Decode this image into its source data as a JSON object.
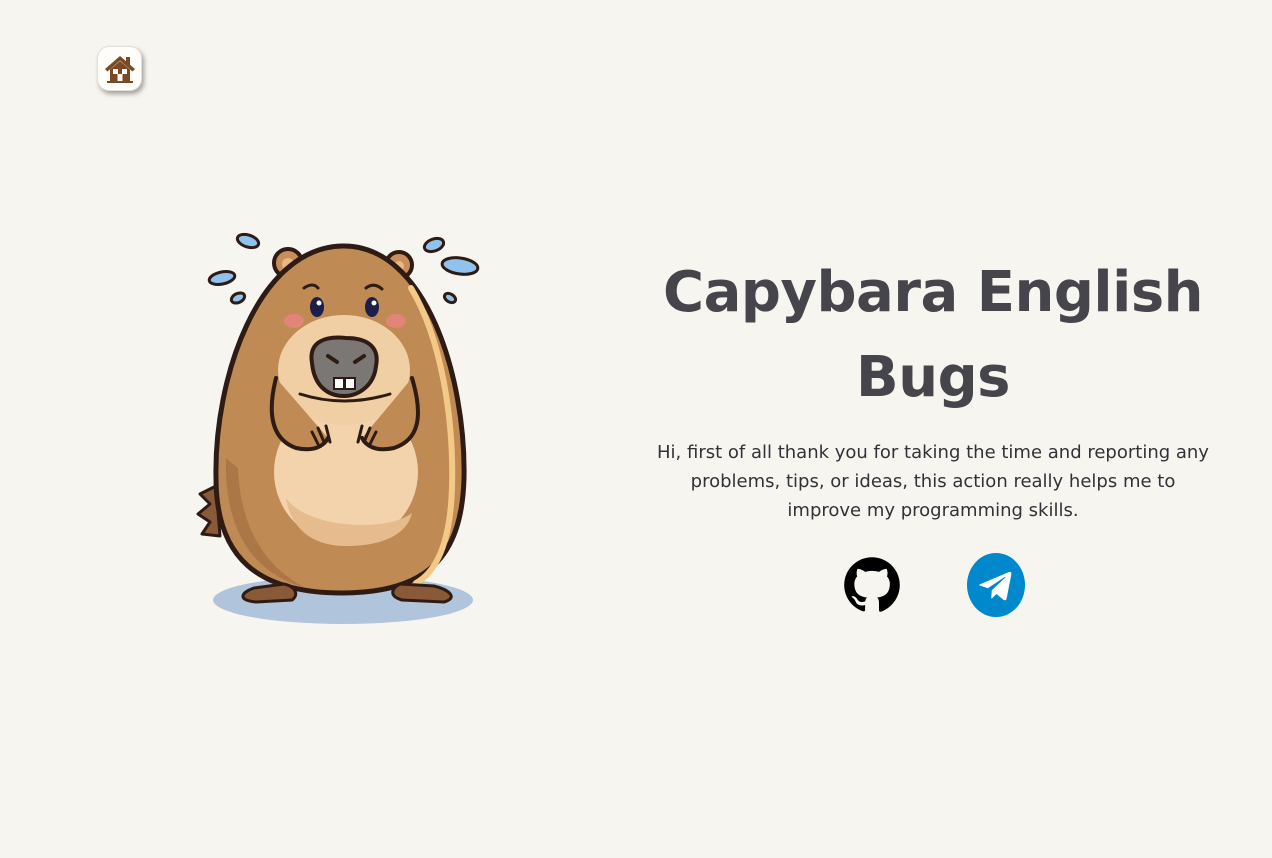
{
  "nav": {
    "home_icon": "home-icon"
  },
  "hero": {
    "mascot": "worried-capybara-illustration",
    "title": "Capybara English Bugs",
    "description": "Hi, first of all thank you for taking the time and reporting any problems, tips, or ideas, this action really helps me to improve my programming skills."
  },
  "socials": [
    {
      "name": "GitHub",
      "icon": "github-icon"
    },
    {
      "name": "Telegram",
      "icon": "telegram-icon",
      "color": "#0088cc"
    }
  ],
  "colors": {
    "background": "#f7f5f0",
    "title": "#47454c",
    "text": "#333137",
    "home_icon": "#7a4a26"
  }
}
